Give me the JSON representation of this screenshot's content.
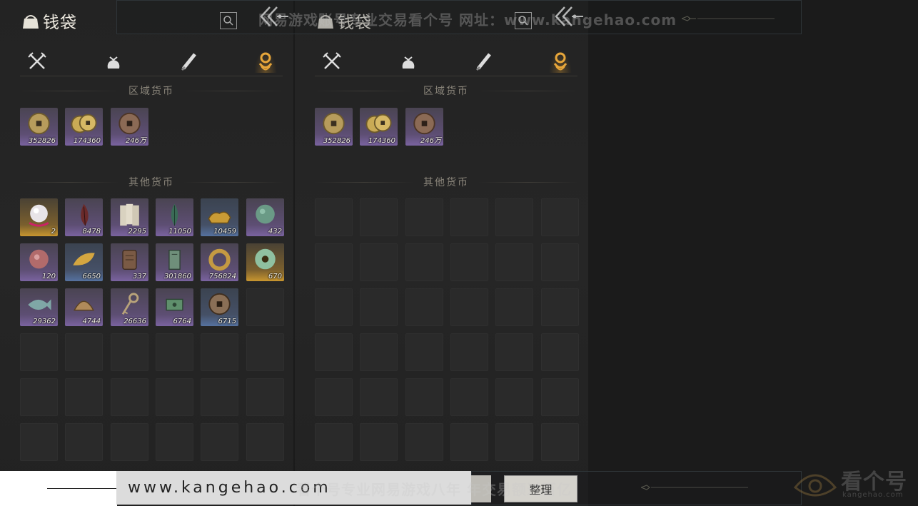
{
  "watermark": {
    "top": "网易游戏账号专业交易看个号  网址：www.kangehao.com",
    "bottom": "看个号专业网易游戏八年  年交易额过百亿",
    "url": "www.kangehao.com",
    "logo_text": "看个号",
    "logo_sub": "kangehao.com"
  },
  "panels": [
    {
      "title": "钱袋",
      "tabs": [
        "weapon-icon",
        "pouch-icon",
        "scroll-icon",
        "currency-icon"
      ],
      "active_tab": 3,
      "section_regional": "区域货币",
      "section_other": "其他货币",
      "regional": [
        {
          "icon": "gold-coin-icon",
          "count": "352826",
          "rarity": "purple"
        },
        {
          "icon": "gold-coins-icon",
          "count": "174360",
          "rarity": "purple"
        },
        {
          "icon": "copper-coin-icon",
          "count": "246万",
          "rarity": "purple"
        }
      ],
      "other": [
        {
          "icon": "pearl-icon",
          "count": "2",
          "rarity": "gold"
        },
        {
          "icon": "red-feather-icon",
          "count": "8478",
          "rarity": "purple"
        },
        {
          "icon": "paper-notes-icon",
          "count": "2295",
          "rarity": "purple"
        },
        {
          "icon": "jade-leaf-icon",
          "count": "11050",
          "rarity": "purple"
        },
        {
          "icon": "gold-ingot-icon",
          "count": "10459",
          "rarity": "blue"
        },
        {
          "icon": "jade-stone-icon",
          "count": "432",
          "rarity": "purple"
        },
        {
          "icon": "red-stone-icon",
          "count": "120",
          "rarity": "purple"
        },
        {
          "icon": "gold-leaf-icon",
          "count": "6650",
          "rarity": "blue"
        },
        {
          "icon": "wood-token-icon",
          "count": "337",
          "rarity": "purple"
        },
        {
          "icon": "jade-token-icon",
          "count": "301860",
          "rarity": "purple"
        },
        {
          "icon": "gold-ring-icon",
          "count": "756824",
          "rarity": "purple"
        },
        {
          "icon": "jade-disc-icon",
          "count": "670",
          "rarity": "gold"
        },
        {
          "icon": "jade-fish-icon",
          "count": "29362",
          "rarity": "purple"
        },
        {
          "icon": "shell-coin-icon",
          "count": "4744",
          "rarity": "purple"
        },
        {
          "icon": "key-icon",
          "count": "26636",
          "rarity": "purple"
        },
        {
          "icon": "jade-bill-icon",
          "count": "6764",
          "rarity": "purple"
        },
        {
          "icon": "bronze-coin-icon",
          "count": "6715",
          "rarity": "blue"
        }
      ],
      "other_slots": 36
    },
    {
      "title": "钱袋",
      "tabs": [
        "weapon-icon",
        "pouch-icon",
        "scroll-icon",
        "currency-icon"
      ],
      "active_tab": 3,
      "section_regional": "区域货币",
      "section_other": "其他货币",
      "regional": [
        {
          "icon": "gold-coin-icon",
          "count": "352826",
          "rarity": "purple"
        },
        {
          "icon": "gold-coins-icon",
          "count": "174360",
          "rarity": "purple"
        },
        {
          "icon": "copper-coin-icon",
          "count": "246万",
          "rarity": "purple"
        }
      ],
      "other": [],
      "other_slots": 36
    }
  ],
  "sort_button": "整理"
}
